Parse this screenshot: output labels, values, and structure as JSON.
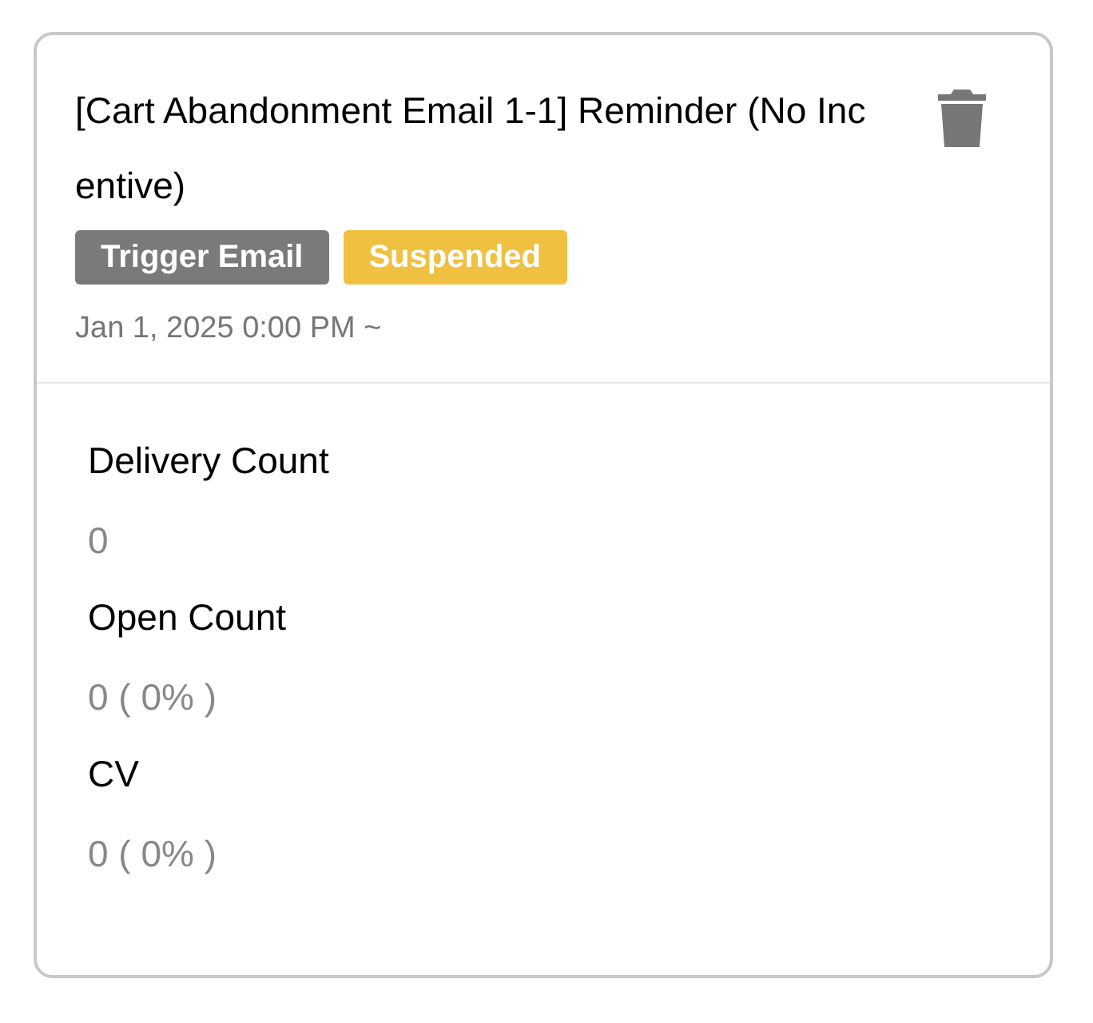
{
  "card": {
    "title": "[Cart Abandonment Email 1-1] Reminder (No Incentive)",
    "tags": [
      {
        "label": "Trigger Email",
        "color": "#7a7a7a"
      },
      {
        "label": "Suspended",
        "color": "#f0c040"
      }
    ],
    "schedule": "Jan 1, 2025 0:00 PM ~",
    "metrics": [
      {
        "label": "Delivery Count",
        "value": "0"
      },
      {
        "label": "Open Count",
        "value": "0 ( 0% )"
      },
      {
        "label": "CV",
        "value": "0 ( 0% )"
      }
    ]
  }
}
